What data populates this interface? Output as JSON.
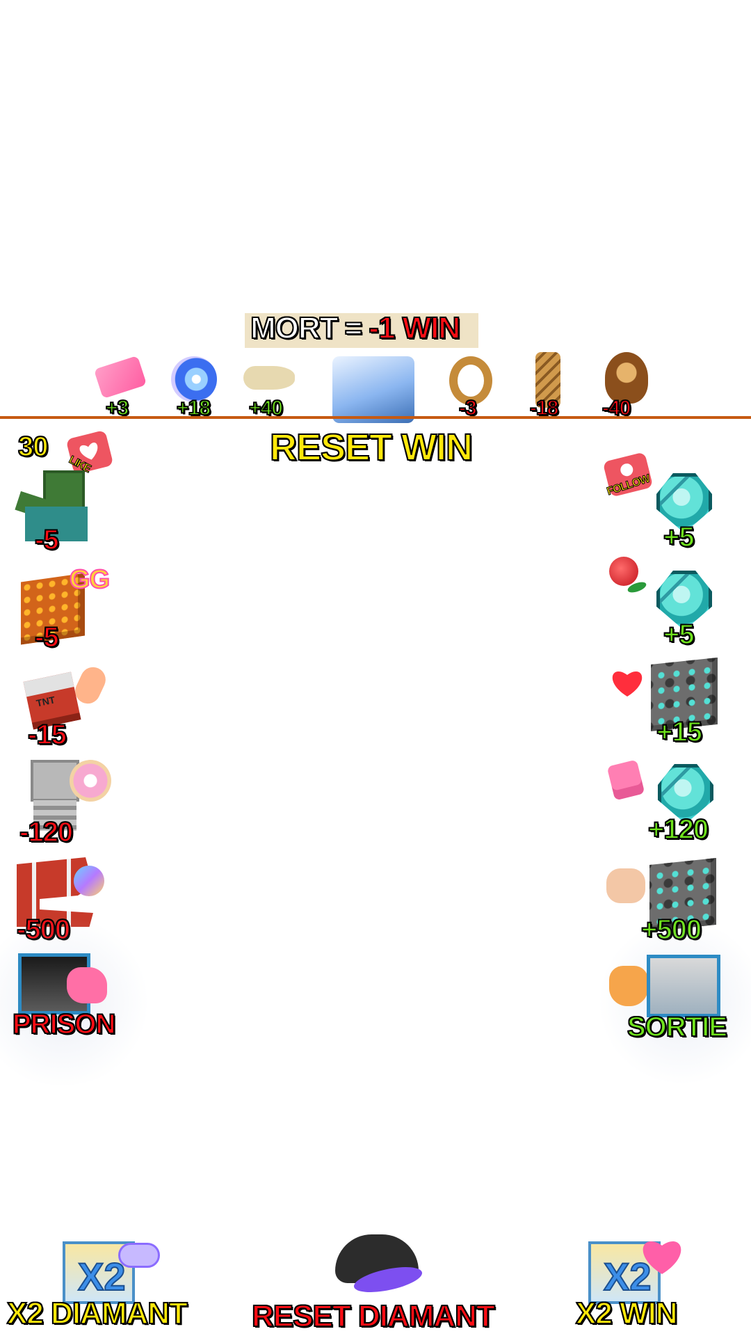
{
  "banner": {
    "mort": "MORT",
    "equals": "=",
    "penalty": "-1 WIN"
  },
  "top_gifts": [
    {
      "icon": "tiktok-ticket-icon",
      "value": "+3"
    },
    {
      "icon": "galaxy-icon",
      "value": "+18"
    },
    {
      "icon": "private-jet-icon",
      "value": "+40"
    },
    {
      "icon": "whale-diving-icon",
      "value": ""
    },
    {
      "icon": "lion-mask-icon",
      "value": "-3"
    },
    {
      "icon": "giraffe-icon",
      "value": "-18"
    },
    {
      "icon": "lion-icon",
      "value": "-40"
    }
  ],
  "reset_win_label": "RESET WIN",
  "like_counter": "30",
  "like_sticker_text": "LIKE",
  "follow_sticker_text": "FOLLOW",
  "left_rules": [
    {
      "mob": "zombie-icon",
      "gift": "like-icon",
      "value": "-5"
    },
    {
      "mob": "magma-block-icon",
      "gift": "gg-icon",
      "value": "-5"
    },
    {
      "mob": "tnt-icon",
      "gift": "finger-heart-icon",
      "value": "-15"
    },
    {
      "mob": "skeleton-icon",
      "gift": "donut-icon",
      "value": "-120"
    },
    {
      "mob": "tnt-pile-icon",
      "gift": "planet-icon",
      "value": "-500"
    },
    {
      "mob": "prison-icon",
      "gift": "boxing-glove-icon",
      "value": "PRISON"
    }
  ],
  "right_rules": [
    {
      "gift": "follow-icon",
      "item": "diamond-icon",
      "value": "+5"
    },
    {
      "gift": "rose-icon",
      "item": "diamond-icon",
      "value": "+5"
    },
    {
      "gift": "heart-icon",
      "item": "diamond-ore-icon",
      "value": "+15"
    },
    {
      "gift": "perfume-icon",
      "item": "diamond-icon",
      "value": "+120"
    },
    {
      "gift": "heart-hands-icon",
      "item": "diamond-ore-icon",
      "value": "+500"
    },
    {
      "gift": "corgi-icon",
      "item": "dove-icon",
      "value": "SORTIE"
    }
  ],
  "bottom_actions": [
    {
      "icon": "x2-card-icon",
      "gift": "gamepad-icon",
      "label": "X2 DIAMANT"
    },
    {
      "icon": "cap-icon",
      "label": "RESET DIAMANT"
    },
    {
      "icon": "x2-card-icon",
      "gift": "hearts-icon",
      "label": "X2 WIN"
    }
  ],
  "card_text": "X2",
  "tnt_text": "TNT",
  "gg_text": "GG",
  "colors": {
    "negative": "#ff0d14",
    "positive": "#6fe31c",
    "highlight": "#ffe80a",
    "divider": "#c65a12",
    "banner_bg": "#efe3c6"
  }
}
